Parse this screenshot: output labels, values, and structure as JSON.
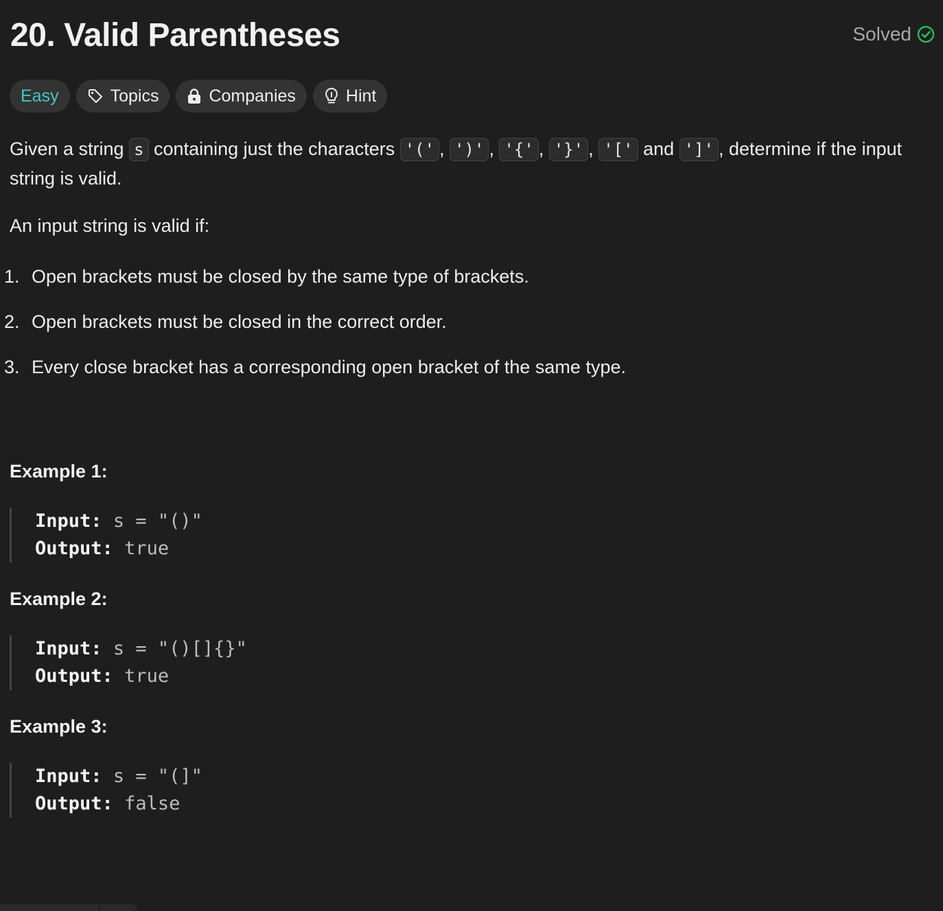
{
  "problem": {
    "title": "20. Valid Parentheses",
    "status": "Solved"
  },
  "tags": {
    "difficulty": "Easy",
    "topics": "Topics",
    "companies": "Companies",
    "hint": "Hint"
  },
  "description": {
    "p1_a": "Given a string ",
    "var_s": "s",
    "p1_b": " containing just the characters ",
    "c1": "'('",
    "c2": "')'",
    "c3": "'{'",
    "c4": "'}'",
    "c5": "'['",
    "c6": "']'",
    "comma": ", ",
    "and": " and ",
    "p1_c": ", determine if the input string is valid.",
    "valid_if": "An input string is valid if:",
    "rules": [
      {
        "num": "1.",
        "text": "Open brackets must be closed by the same type of brackets."
      },
      {
        "num": "2.",
        "text": "Open brackets must be closed in the correct order."
      },
      {
        "num": "3.",
        "text": "Every close bracket has a corresponding open bracket of the same type."
      }
    ]
  },
  "examples": [
    {
      "title": "Example 1:",
      "input_label": "Input:",
      "input": "s = \"()\"",
      "output_label": "Output:",
      "output": "true"
    },
    {
      "title": "Example 2:",
      "input_label": "Input:",
      "input": "s = \"()[]{}\"",
      "output_label": "Output:",
      "output": "true"
    },
    {
      "title": "Example 3:",
      "input_label": "Input:",
      "input": "s = \"(]\"",
      "output_label": "Output:",
      "output": "false"
    }
  ],
  "colors": {
    "background": "#1e1e1e",
    "easy": "#46c6c2",
    "solved_check": "#2cbb5d",
    "tag_bg": "#333333"
  },
  "icons": [
    "tag-icon",
    "lock-icon",
    "lightbulb-icon",
    "check-circle-icon"
  ]
}
